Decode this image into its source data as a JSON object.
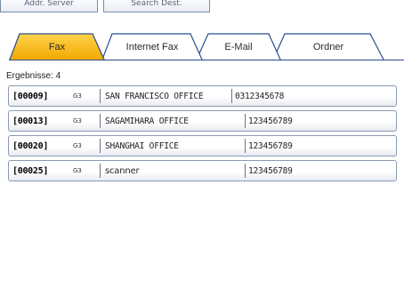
{
  "top_buttons": [
    {
      "label": "Addr. Server"
    },
    {
      "label": "Search Dest."
    }
  ],
  "tabs": [
    {
      "label": "Fax",
      "selected": true
    },
    {
      "label": "Internet Fax",
      "selected": false
    },
    {
      "label": "E-Mail",
      "selected": false
    },
    {
      "label": "Ordner",
      "selected": false
    }
  ],
  "results_label": "Ergebnisse: 4",
  "entries": [
    {
      "code": "[00009]",
      "type": "G3",
      "name": "SAN FRANCISCO OFFICE",
      "number": "0312345678"
    },
    {
      "code": "[00013]",
      "type": "G3",
      "name": "SAGAMIHARA OFFICE",
      "number": "123456789"
    },
    {
      "code": "[00020]",
      "type": "G3",
      "name": "SHANGHAI OFFICE",
      "number": "123456789"
    },
    {
      "code": "[00025]",
      "type": "G3",
      "name": "scanner",
      "number": "123456789"
    }
  ],
  "colors": {
    "tab_selected": "#f7b400",
    "tab_border": "#2b4f8e",
    "row_border": "#8b9ab3"
  }
}
